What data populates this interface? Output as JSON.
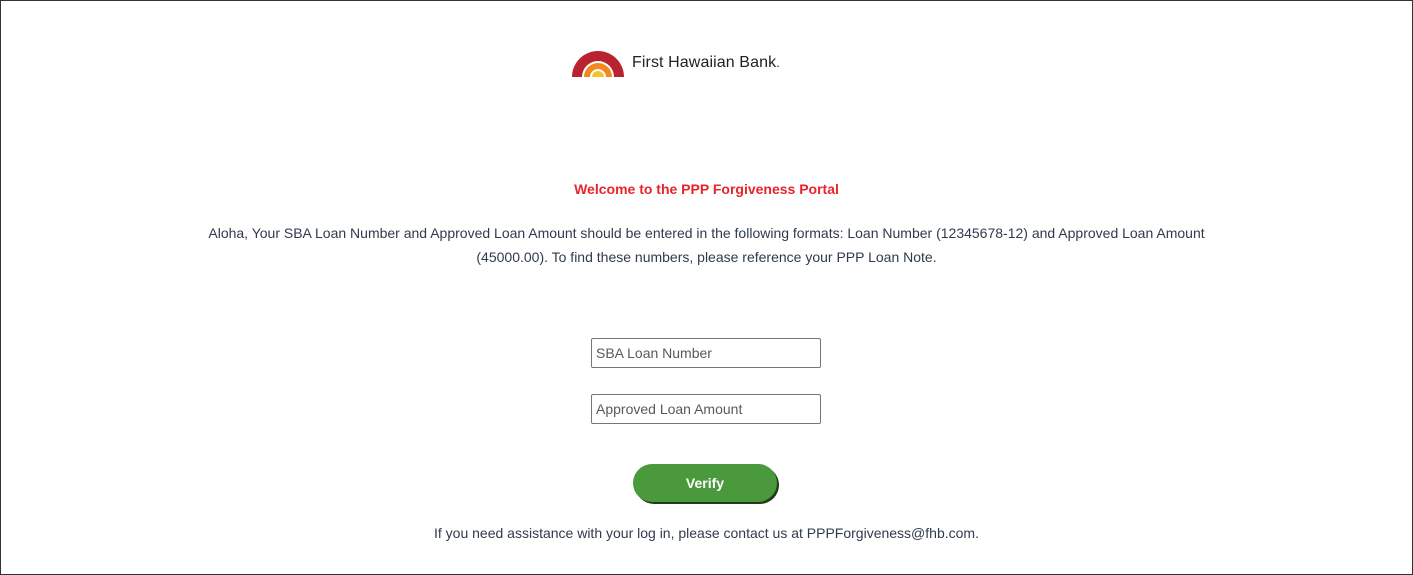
{
  "brand": {
    "name": "First Hawaiian Bank",
    "suffix": "."
  },
  "welcome_title": "Welcome to the PPP Forgiveness Portal",
  "intro": {
    "line1": "Aloha, Your SBA Loan Number and Approved Loan Amount should be entered in the following formats: Loan Number (12345678-12) and Approved Loan Amount",
    "line2": "(45000.00). To find these numbers, please reference your PPP Loan Note."
  },
  "form": {
    "loan_number": {
      "placeholder": "SBA Loan Number",
      "value": ""
    },
    "loan_amount": {
      "placeholder": "Approved Loan Amount",
      "value": ""
    },
    "verify_label": "Verify"
  },
  "help_text": "If you need assistance with your log in, please contact us at PPPForgiveness@fhb.com.",
  "colors": {
    "welcome": "#e8242b",
    "button": "#4a9a3d",
    "logo_red": "#b8232f",
    "logo_orange": "#f08a1c",
    "logo_yellow": "#f6c12d"
  },
  "icons": {
    "logo_mark": "rainbow-logo-icon"
  }
}
